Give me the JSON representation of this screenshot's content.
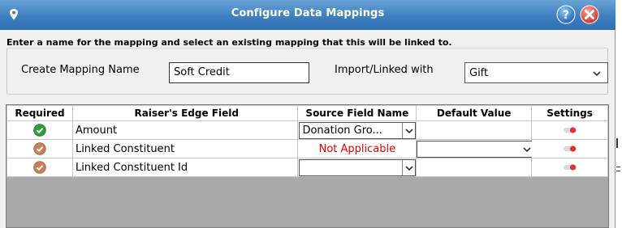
{
  "window": {
    "title": "Configure  Data Mappings"
  },
  "form": {
    "instruction": "Enter a name for the mapping and select an existing mapping that this will be linked to.",
    "mapping_name_label": "Create Mapping Name",
    "mapping_name_value": "Soft Credit",
    "import_label": "Import/Linked with",
    "import_value": "Gift"
  },
  "table": {
    "headers": [
      "Required",
      "Raiser's Edge Field",
      "Source Field Name",
      "Default Value",
      "Settings"
    ],
    "rows": [
      {
        "required": "required-green",
        "field": "Amount",
        "source": "Donation Gro...",
        "source_type": "select",
        "default": "",
        "default_type": "text"
      },
      {
        "required": "optional-brown",
        "field": "Linked Constituent",
        "source": "Not Applicable",
        "source_type": "text",
        "default": "",
        "default_type": "select"
      },
      {
        "required": "optional-brown",
        "field": "Linked Constituent Id",
        "source": "",
        "source_type": "select",
        "default": "",
        "default_type": "text"
      }
    ]
  },
  "colors": {
    "title_bar": "#3e7fc0",
    "required_green": "#2e9e3a",
    "optional_brown": "#c97f58",
    "not_applicable": "#e00000",
    "close_red": "#d9403a",
    "help_blue": "#2f7fd0"
  },
  "icons": {
    "pin": "pin-icon",
    "help": "help-icon",
    "close": "close-icon",
    "toggle": "toggle-icon"
  }
}
